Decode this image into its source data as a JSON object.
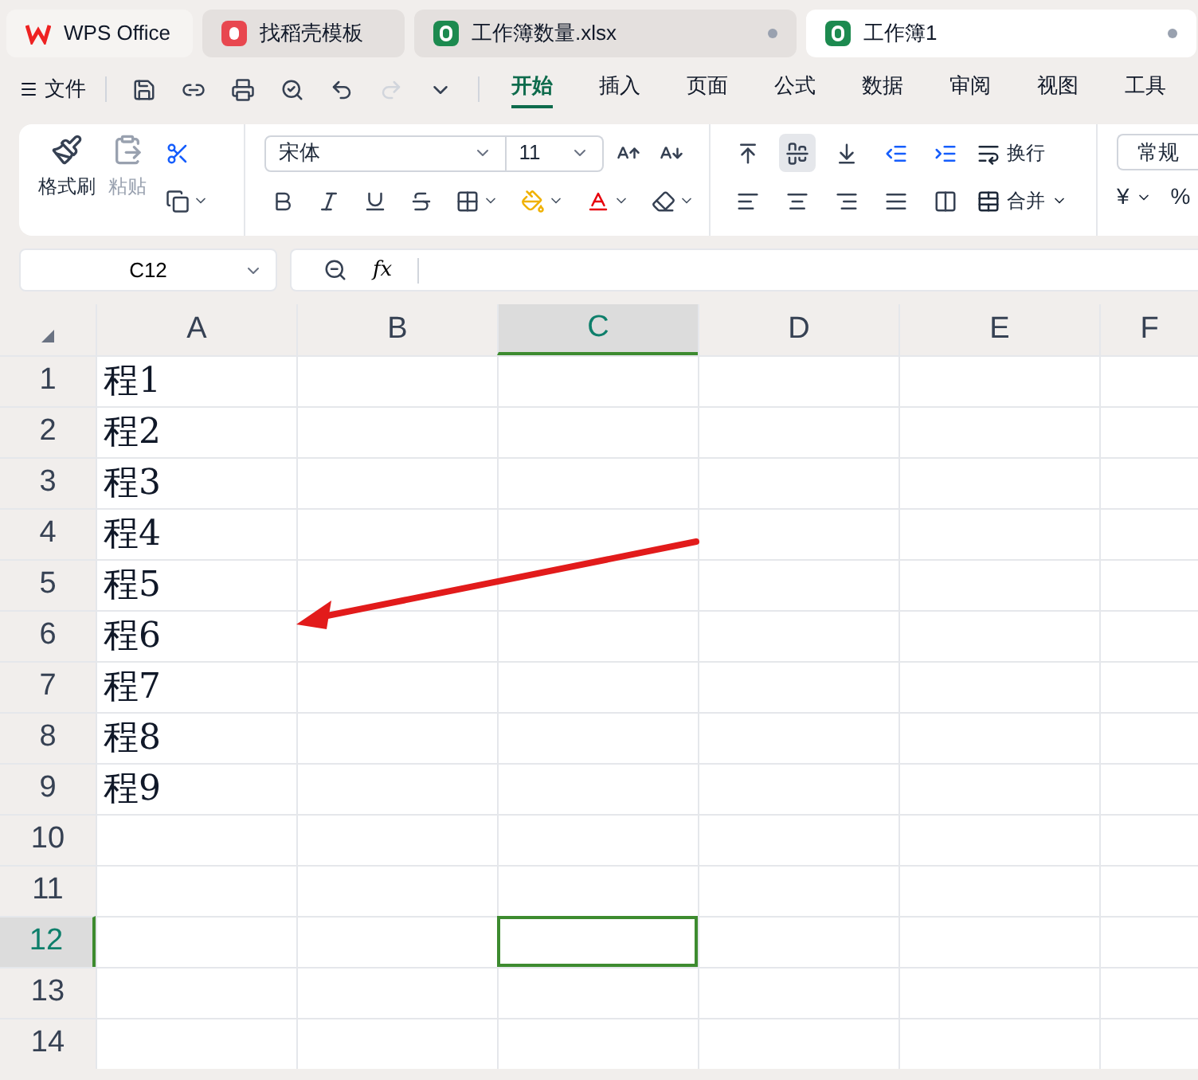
{
  "app_tabs": [
    {
      "kind": "wps",
      "label": "WPS Office",
      "selected": false
    },
    {
      "kind": "template",
      "label": "找稻壳模板",
      "selected": false
    },
    {
      "kind": "sheet",
      "label": "工作簿数量.xlsx",
      "selected": false
    },
    {
      "kind": "sheet",
      "label": "工作簿1",
      "selected": true
    }
  ],
  "file_menu": "文件",
  "ribbon_tabs": [
    {
      "label": "开始",
      "selected": true
    },
    {
      "label": "插入",
      "selected": false
    },
    {
      "label": "页面",
      "selected": false
    },
    {
      "label": "公式",
      "selected": false
    },
    {
      "label": "数据",
      "selected": false
    },
    {
      "label": "审阅",
      "selected": false
    },
    {
      "label": "视图",
      "selected": false
    },
    {
      "label": "工具",
      "selected": false
    }
  ],
  "clipboard": {
    "format_painter": "格式刷",
    "paste": {
      "label": "粘贴",
      "disabled": true
    }
  },
  "font": {
    "name": "宋体",
    "size": "11"
  },
  "vertical_align": [
    {
      "selected": false
    },
    {
      "selected": true
    },
    {
      "selected": false
    }
  ],
  "wrap_label": "换行",
  "merge_label": "合并",
  "number_format": "常规",
  "currency": "¥",
  "percent": "%",
  "name_box": "C12",
  "fx": "fx",
  "columns": [
    {
      "label": "A",
      "selected": false
    },
    {
      "label": "B",
      "selected": false
    },
    {
      "label": "C",
      "selected": true
    },
    {
      "label": "D",
      "selected": false
    },
    {
      "label": "E",
      "selected": false
    },
    {
      "label": "F",
      "selected": false
    }
  ],
  "rows": [
    {
      "label": "1",
      "selected": false,
      "cells": [
        "程1"
      ]
    },
    {
      "label": "2",
      "selected": false,
      "cells": [
        "程2"
      ]
    },
    {
      "label": "3",
      "selected": false,
      "cells": [
        "程3"
      ]
    },
    {
      "label": "4",
      "selected": false,
      "cells": [
        "程4"
      ]
    },
    {
      "label": "5",
      "selected": false,
      "cells": [
        "程5"
      ]
    },
    {
      "label": "6",
      "selected": false,
      "cells": [
        "程6"
      ]
    },
    {
      "label": "7",
      "selected": false,
      "cells": [
        "程7"
      ]
    },
    {
      "label": "8",
      "selected": false,
      "cells": [
        "程8"
      ]
    },
    {
      "label": "9",
      "selected": false,
      "cells": [
        "程9"
      ]
    },
    {
      "label": "10",
      "selected": false
    },
    {
      "label": "11",
      "selected": false
    },
    {
      "label": "12",
      "selected": true
    },
    {
      "label": "13",
      "selected": false
    },
    {
      "label": "14",
      "selected": false
    }
  ]
}
